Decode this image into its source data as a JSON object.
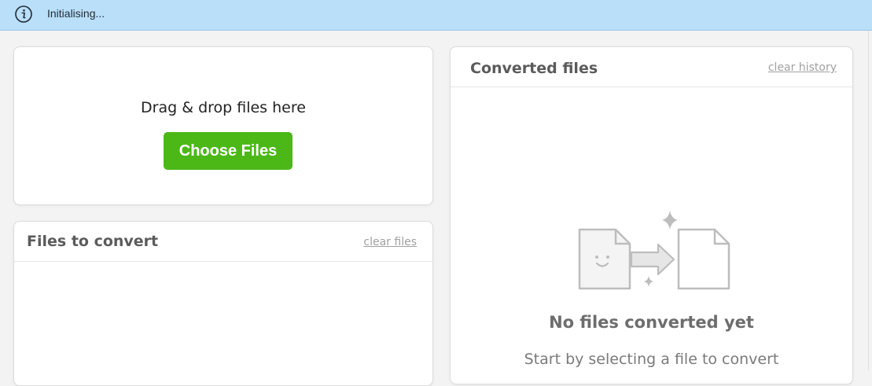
{
  "banner": {
    "icon": "info-icon",
    "text": "Initialising..."
  },
  "upload": {
    "drop_text": "Drag & drop files here",
    "choose_button": "Choose Files"
  },
  "files_to_convert": {
    "title": "Files to convert",
    "clear_link": "clear files"
  },
  "converted_files": {
    "title": "Converted files",
    "clear_link": "clear history",
    "empty_title": "No files converted yet",
    "empty_subtitle": "Start by selecting a file to convert",
    "illustration_icon": "file-convert-icon"
  },
  "colors": {
    "banner_bg": "#b9dff9",
    "primary_button": "#4cb818"
  }
}
